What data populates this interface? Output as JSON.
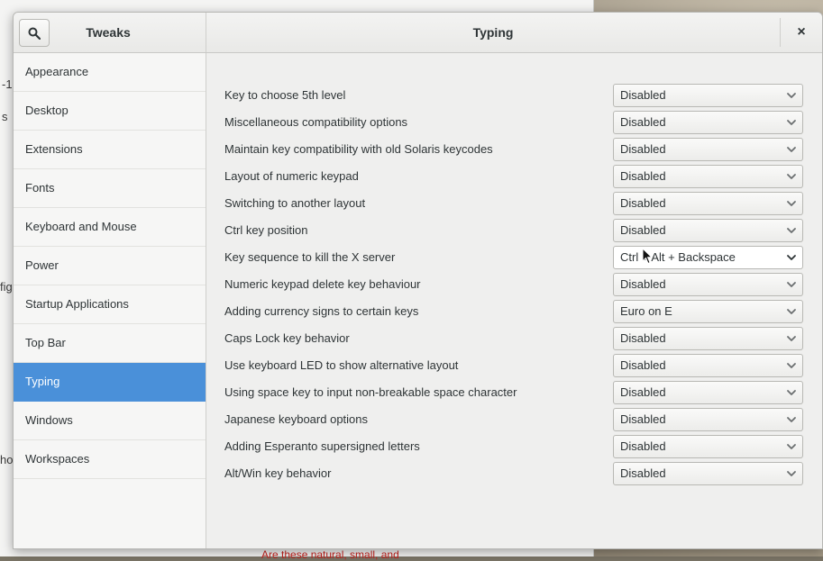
{
  "background": {
    "fragments": [
      "-1",
      "s",
      "fig",
      "ho"
    ],
    "link_text": "Are these natural, small, and"
  },
  "window": {
    "app_title": "Tweaks",
    "page_title": "Typing",
    "close_label": "×"
  },
  "sidebar": {
    "items": [
      {
        "label": "Appearance"
      },
      {
        "label": "Desktop"
      },
      {
        "label": "Extensions"
      },
      {
        "label": "Fonts"
      },
      {
        "label": "Keyboard and Mouse"
      },
      {
        "label": "Power"
      },
      {
        "label": "Startup Applications"
      },
      {
        "label": "Top Bar"
      },
      {
        "label": "Typing"
      },
      {
        "label": "Windows"
      },
      {
        "label": "Workspaces"
      }
    ],
    "active": "Typing",
    "accent_color": "#4a90d9"
  },
  "settings": [
    {
      "label": "Key to choose 5th level",
      "value": "Disabled"
    },
    {
      "label": "Miscellaneous compatibility options",
      "value": "Disabled"
    },
    {
      "label": "Maintain key compatibility with old Solaris keycodes",
      "value": "Disabled"
    },
    {
      "label": "Layout of numeric keypad",
      "value": "Disabled"
    },
    {
      "label": "Switching to another layout",
      "value": "Disabled"
    },
    {
      "label": "Ctrl key position",
      "value": "Disabled"
    },
    {
      "label": "Key sequence to kill the X server",
      "value": "Ctrl + Alt + Backspace"
    },
    {
      "label": "Numeric keypad delete key behaviour",
      "value": "Disabled"
    },
    {
      "label": "Adding currency signs to certain keys",
      "value": "Euro on E"
    },
    {
      "label": "Caps Lock key behavior",
      "value": "Disabled"
    },
    {
      "label": "Use keyboard LED to show alternative layout",
      "value": "Disabled"
    },
    {
      "label": "Using space key to input non-breakable space character",
      "value": "Disabled"
    },
    {
      "label": "Japanese keyboard options",
      "value": "Disabled"
    },
    {
      "label": "Adding Esperanto supersigned letters",
      "value": "Disabled"
    },
    {
      "label": "Alt/Win key behavior",
      "value": "Disabled"
    }
  ]
}
